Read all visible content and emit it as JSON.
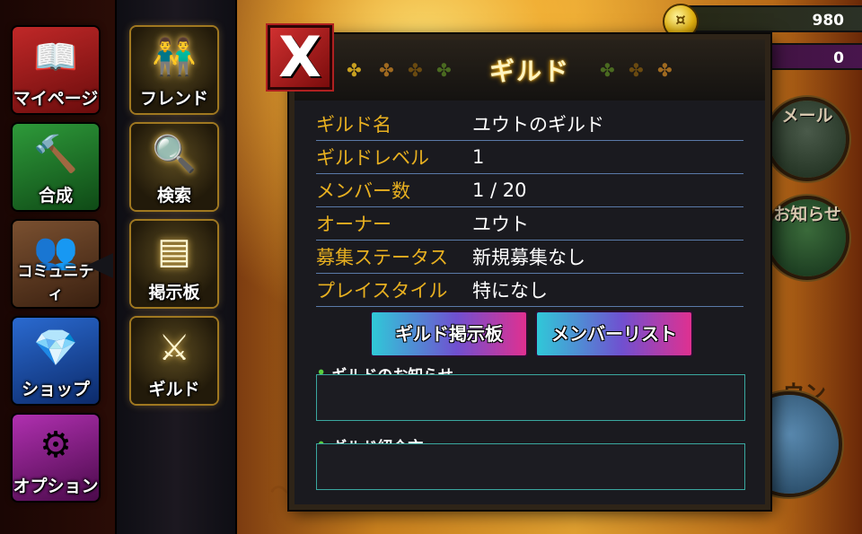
{
  "currency": {
    "coins": "980",
    "gems": "0"
  },
  "menu": {
    "items": [
      {
        "label": "マイページ",
        "icon": "open-book-icon"
      },
      {
        "label": "合成",
        "icon": "hammer-wrench-icon"
      },
      {
        "label": "コミュニティ",
        "icon": "characters-icon"
      },
      {
        "label": "ショップ",
        "icon": "coins-gems-icon"
      },
      {
        "label": "オプション",
        "icon": "gears-icon"
      }
    ]
  },
  "submenu": {
    "items": [
      {
        "label": "フレンド",
        "icon": "friends-icon"
      },
      {
        "label": "検索",
        "icon": "magnifier-icon"
      },
      {
        "label": "掲示板",
        "icon": "signboard-icon"
      },
      {
        "label": "ギルド",
        "icon": "crossed-swords-icon"
      }
    ]
  },
  "side": {
    "mail": "メール",
    "news": "お知らせ",
    "town": "ウン"
  },
  "panel": {
    "title": "ギルド",
    "close": "X",
    "rows": [
      {
        "key": "ギルド名",
        "value": "ユウトのギルド"
      },
      {
        "key": "ギルドレベル",
        "value": "1"
      },
      {
        "key": "メンバー数",
        "value": "1 / 20"
      },
      {
        "key": "オーナー",
        "value": "ユウト"
      },
      {
        "key": "募集ステータス",
        "value": "新規募集なし"
      },
      {
        "key": "プレイスタイル",
        "value": "特になし"
      }
    ],
    "buttons": {
      "board": "ギルド掲示板",
      "members": "メンバーリスト"
    },
    "news_label": "ギルドのお知らせ",
    "news_text": "",
    "intro_label": "ギルド紹介文",
    "intro_text": ""
  },
  "colors": {
    "key_text": "#e8b020",
    "title_glow": "#ffb000",
    "close_red": "#d03030"
  }
}
